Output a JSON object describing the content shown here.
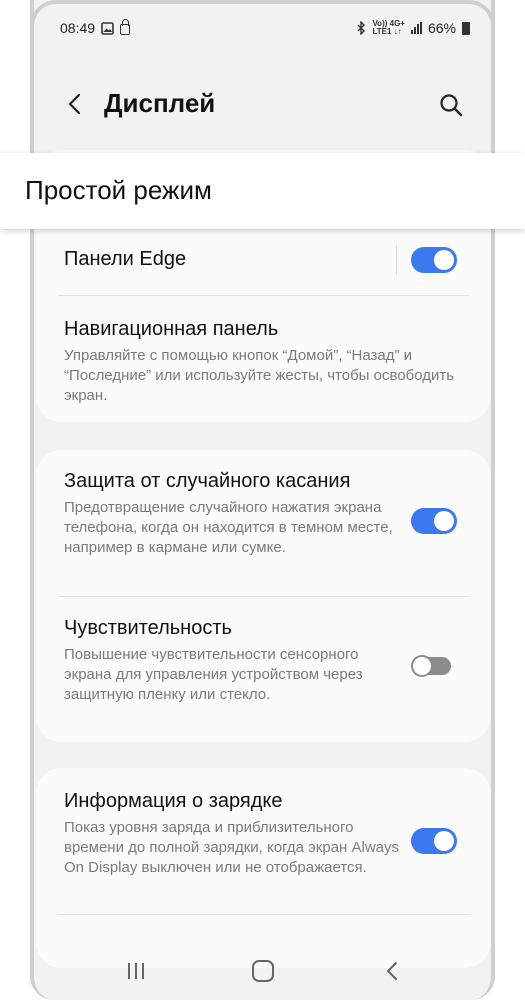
{
  "status_bar": {
    "time": "08:49",
    "net_top": "Vo)) 4G+",
    "net_bottom": "LTE1 ↓↑",
    "battery": "66%",
    "icons": [
      "gallery-icon",
      "lock-icon",
      "bluetooth-icon",
      "signal-icon",
      "battery-icon"
    ]
  },
  "header": {
    "title": "Дисплей",
    "back_icon": "back-arrow-icon",
    "search_icon": "search-icon"
  },
  "banner": {
    "text": "Простой режим"
  },
  "settings": {
    "edge_panels": {
      "title": "Панели Edge",
      "toggle_on": true
    },
    "navigation_bar": {
      "title": "Навигационная панель",
      "description": "Управляйте с помощью кнопок “Домой”, “Назад” и “Последние” или используйте жесты, чтобы освободить экран."
    },
    "accidental_touch": {
      "title": "Защита от случайного касания",
      "description": "Предотвращение случайного нажатия экрана телефона, когда он находится в темном месте, например в кармане или сумке.",
      "toggle_on": true
    },
    "touch_sensitivity": {
      "title": "Чувствительность",
      "description": "Повышение чувствительности сенсорного экрана для управления устройством через защитную пленку или стекло.",
      "toggle_on": false
    },
    "charging_info": {
      "title": "Информация о зарядке",
      "description": "Показ уровня заряда и приблизительного времени до полной зарядки, когда экран Always On Display выключен или не отображается.",
      "toggle_on": true
    }
  },
  "colors": {
    "accent": "#3b79ef",
    "background": "#f2f2f2",
    "card": "#fbfbfb"
  },
  "nav_bar": {
    "icons": [
      "recent-apps-icon",
      "home-icon",
      "back-icon"
    ]
  }
}
